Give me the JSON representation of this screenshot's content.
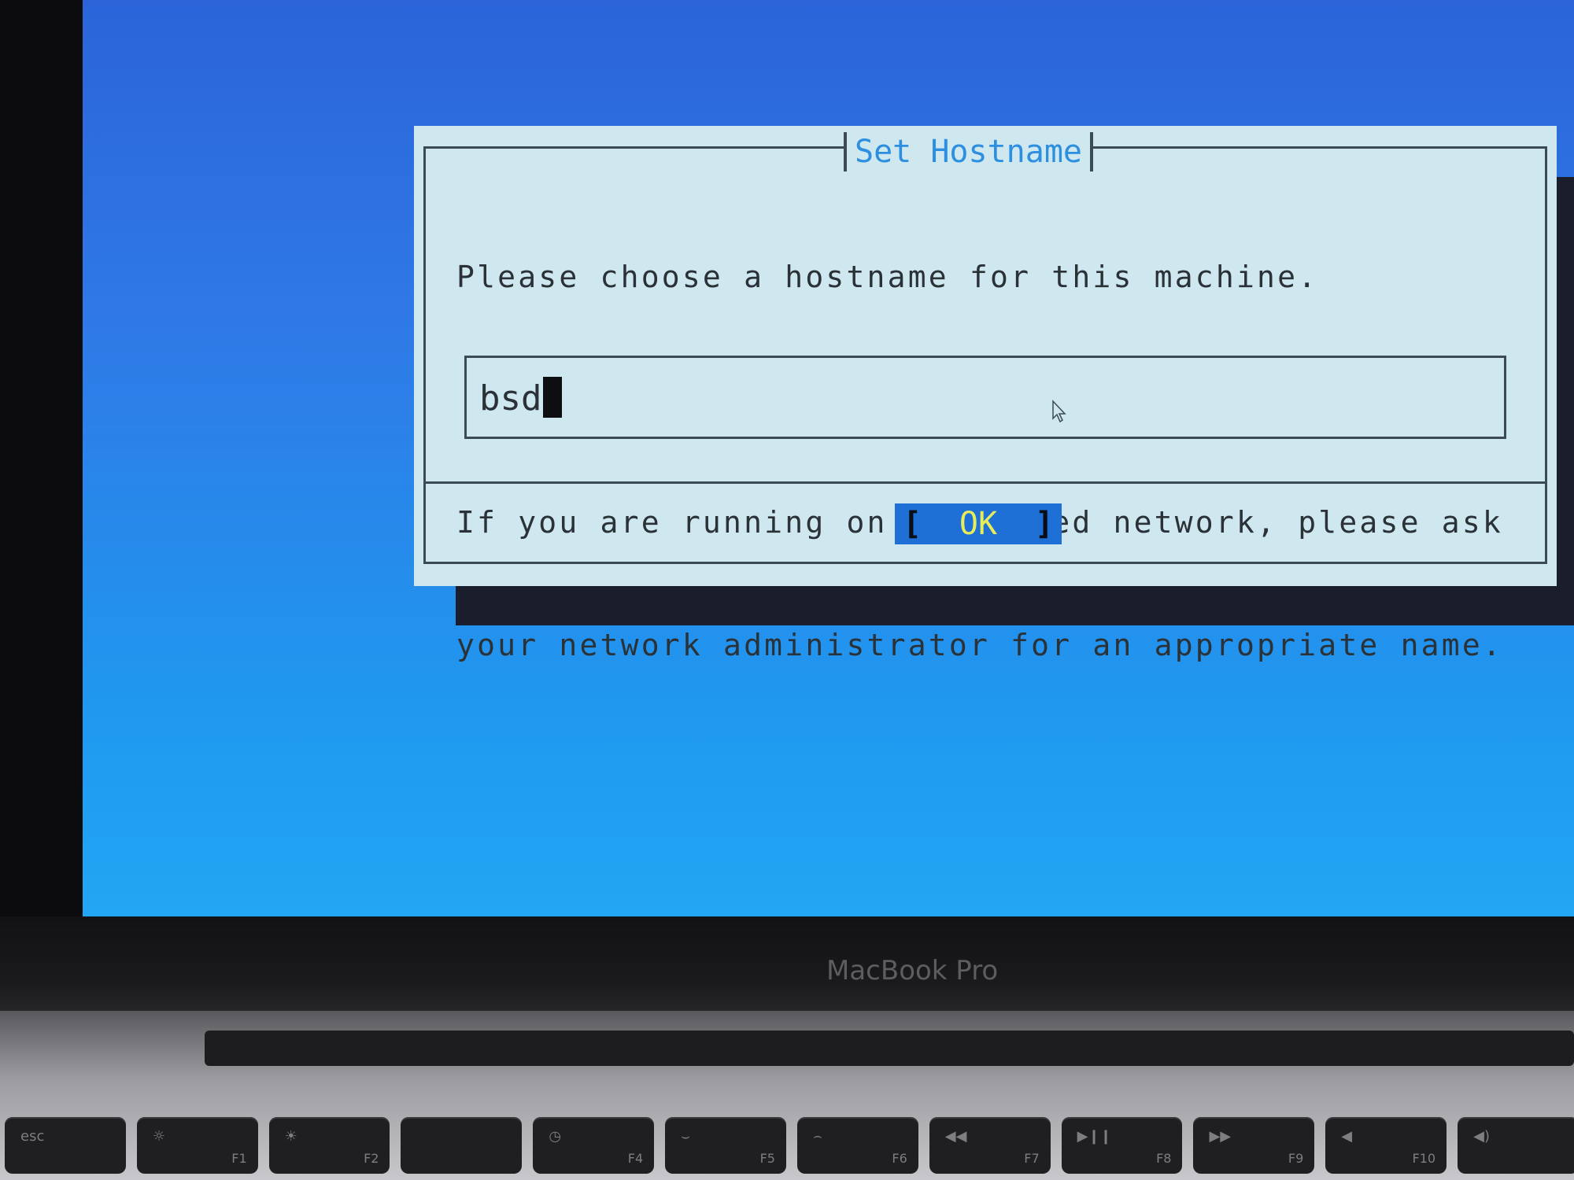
{
  "dialog": {
    "title": "Set Hostname",
    "message_line1": "Please choose a hostname for this machine.",
    "message_line2": "If you are running on a managed network, please ask",
    "message_line3": "your network administrator for an appropriate name.",
    "input_value": "bsd",
    "ok_label": "OK",
    "ok_bracket_left": "[",
    "ok_bracket_right": "]"
  },
  "device": {
    "brand_label": "MacBook Pro"
  },
  "keyboard": {
    "keys": [
      {
        "main": "esc",
        "fn": ""
      },
      {
        "main": "☼",
        "fn": "F1"
      },
      {
        "main": "☀",
        "fn": "F2"
      },
      {
        "main": "",
        "fn": ""
      },
      {
        "main": "◷",
        "fn": "F4"
      },
      {
        "main": "⌣",
        "fn": "F5"
      },
      {
        "main": "⌢",
        "fn": "F6"
      },
      {
        "main": "◀◀",
        "fn": "F7"
      },
      {
        "main": "▶❙❙",
        "fn": "F8"
      },
      {
        "main": "▶▶",
        "fn": "F9"
      },
      {
        "main": "◀",
        "fn": "F10"
      },
      {
        "main": "◀)",
        "fn": ""
      }
    ]
  }
}
